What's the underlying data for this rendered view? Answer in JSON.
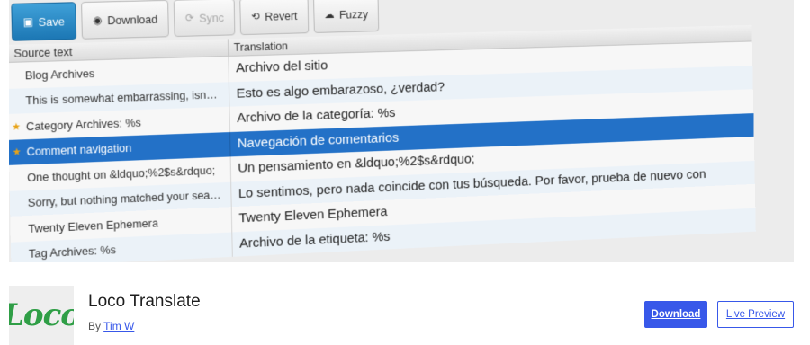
{
  "toolbar": {
    "save_label": "Save",
    "download_label": "Download",
    "sync_label": "Sync",
    "revert_label": "Revert",
    "fuzzy_label": "Fuzzy"
  },
  "grid": {
    "source_header": "Source text",
    "translation_header": "Translation",
    "rows": [
      {
        "source": "Blog Archives",
        "translation": "Archivo del sitio",
        "starred": false,
        "selected": false
      },
      {
        "source": "This is somewhat embarrassing, isn…",
        "translation": "Esto es algo embarazoso, ¿verdad?",
        "starred": false,
        "selected": false
      },
      {
        "source": "Category Archives: %s",
        "translation": "Archivo de la categoría: %s",
        "starred": true,
        "selected": false
      },
      {
        "source": "Comment navigation",
        "translation": "Navegación de comentarios",
        "starred": true,
        "selected": true
      },
      {
        "source": "One thought on &ldquo;%2$s&rdquo;",
        "translation": "Un pensamiento en &ldquo;%2$s&rdquo;",
        "starred": false,
        "selected": false
      },
      {
        "source": "Sorry, but nothing matched your sea…",
        "translation": "Lo sentimos, pero nada coincide con tus búsqueda. Por favor, prueba de nuevo con",
        "starred": false,
        "selected": false
      },
      {
        "source": "Twenty Eleven Ephemera",
        "translation": "Twenty Eleven Ephemera",
        "starred": false,
        "selected": false
      },
      {
        "source": "Tag Archives: %s",
        "translation": "Archivo de la etiqueta: %s",
        "starred": false,
        "selected": false
      }
    ]
  },
  "plugin": {
    "logo_text": "Loco",
    "name": "Loco Translate",
    "by_label": "By",
    "author": "Tim W",
    "download_label": "Download",
    "preview_label": "Live Preview"
  },
  "colors": {
    "accent": "#3858e9",
    "selected_row": "#2371c7",
    "save_button": "#1c77b4",
    "logo_green": "#2f9e46"
  }
}
